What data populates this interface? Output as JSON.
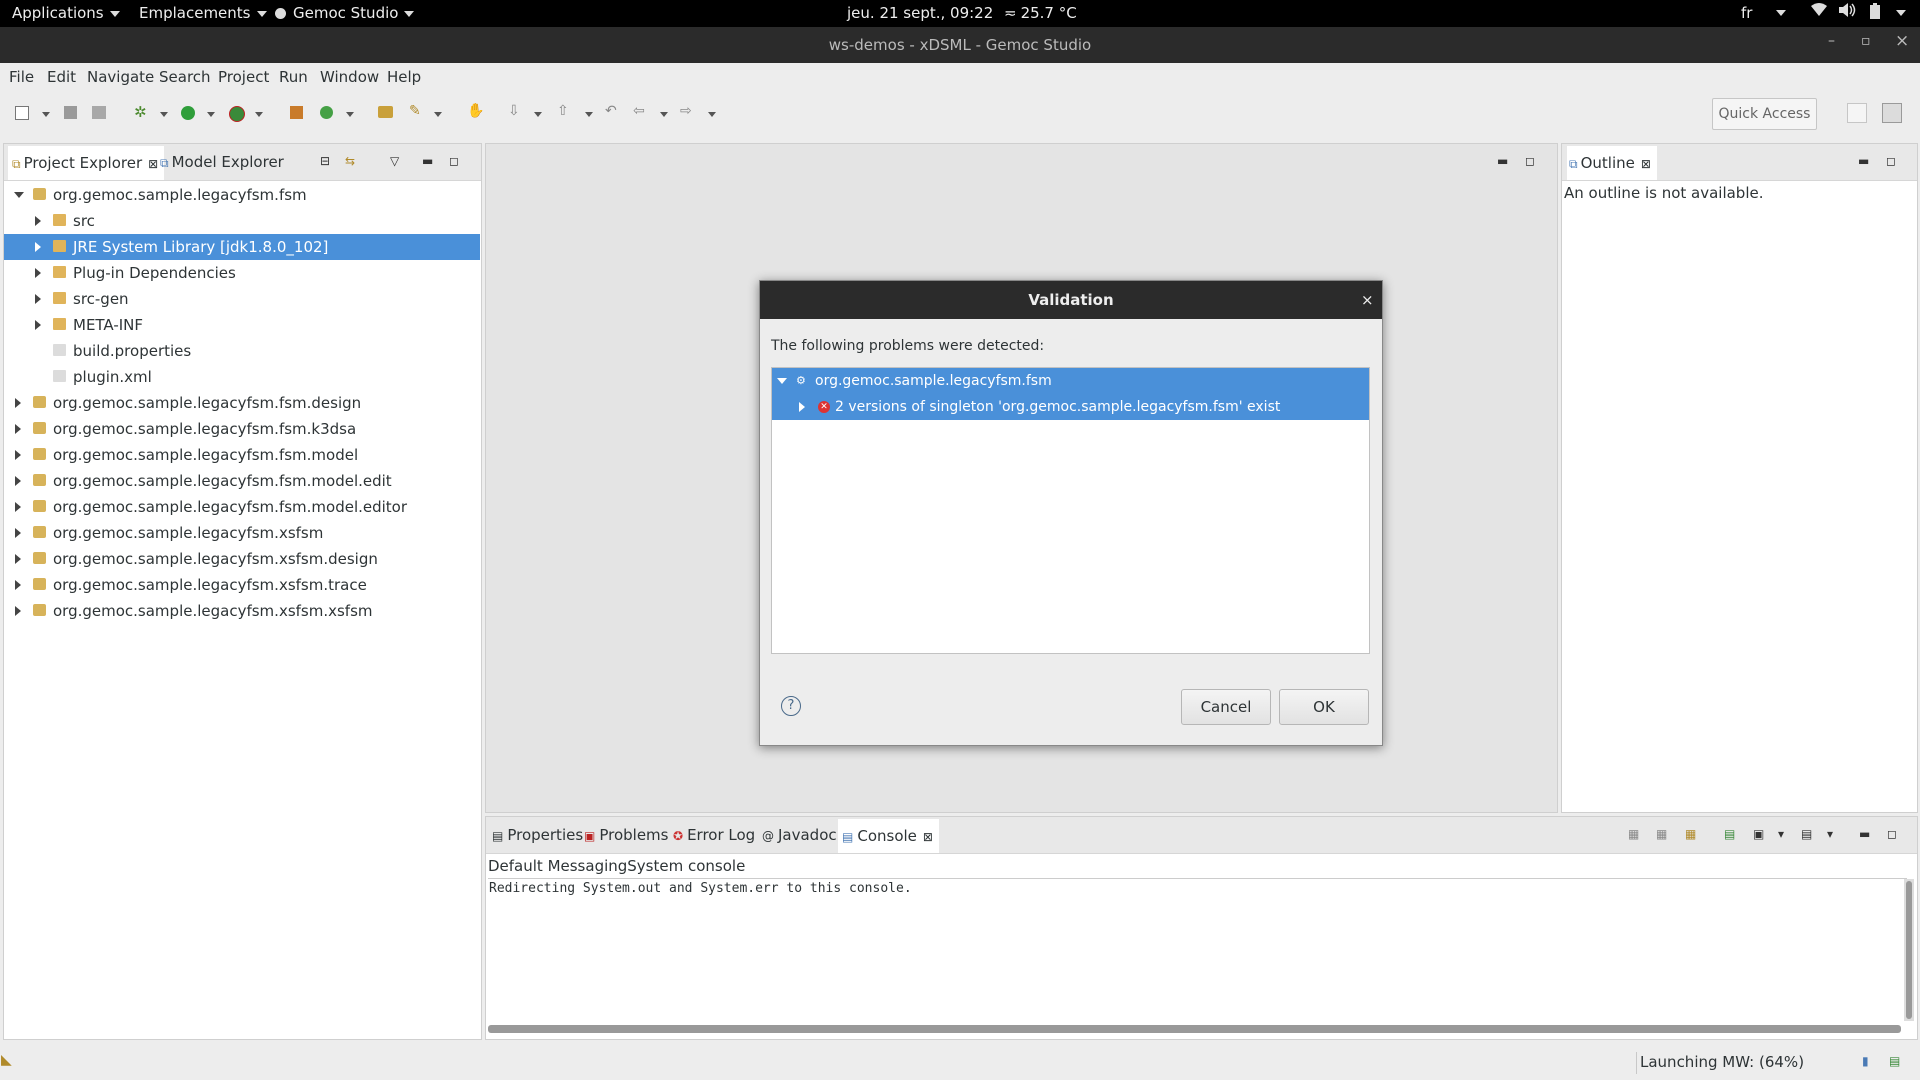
{
  "topbar": {
    "applications": "Applications",
    "places": "Emplacements",
    "app_name": "Gemoc Studio",
    "clock": "jeu. 21 sept., 09:22",
    "temperature": "25.7 °C",
    "lang": "fr"
  },
  "window": {
    "title": "ws-demos - xDSML - Gemoc Studio",
    "minimize": "–",
    "maximize": "▫",
    "close": "×"
  },
  "menubar": [
    "File",
    "Edit",
    "Navigate",
    "Search",
    "Project",
    "Run",
    "Window",
    "Help"
  ],
  "toolbar": {
    "quick_access": "Quick Access"
  },
  "project_explorer": {
    "tabs": [
      "Project Explorer",
      "Model Explorer"
    ],
    "tree": [
      {
        "label": "org.gemoc.sample.legacyfsm.fsm",
        "level": 0,
        "expanded": true,
        "selected": false
      },
      {
        "label": "src",
        "level": 1,
        "expanded": false,
        "selected": false
      },
      {
        "label": "JRE System Library [jdk1.8.0_102]",
        "level": 1,
        "expanded": false,
        "selected": true
      },
      {
        "label": "Plug-in Dependencies",
        "level": 1,
        "expanded": false,
        "selected": false
      },
      {
        "label": "src-gen",
        "level": 1,
        "expanded": false,
        "selected": false
      },
      {
        "label": "META-INF",
        "level": 1,
        "expanded": false,
        "selected": false
      },
      {
        "label": "build.properties",
        "level": 1,
        "leaf": true,
        "selected": false
      },
      {
        "label": "plugin.xml",
        "level": 1,
        "leaf": true,
        "selected": false
      },
      {
        "label": "org.gemoc.sample.legacyfsm.fsm.design",
        "level": 0,
        "expanded": false,
        "selected": false
      },
      {
        "label": "org.gemoc.sample.legacyfsm.fsm.k3dsa",
        "level": 0,
        "expanded": false,
        "selected": false
      },
      {
        "label": "org.gemoc.sample.legacyfsm.fsm.model",
        "level": 0,
        "expanded": false,
        "selected": false
      },
      {
        "label": "org.gemoc.sample.legacyfsm.fsm.model.edit",
        "level": 0,
        "expanded": false,
        "selected": false
      },
      {
        "label": "org.gemoc.sample.legacyfsm.fsm.model.editor",
        "level": 0,
        "expanded": false,
        "selected": false
      },
      {
        "label": "org.gemoc.sample.legacyfsm.xsfsm",
        "level": 0,
        "expanded": false,
        "selected": false
      },
      {
        "label": "org.gemoc.sample.legacyfsm.xsfsm.design",
        "level": 0,
        "expanded": false,
        "selected": false
      },
      {
        "label": "org.gemoc.sample.legacyfsm.xsfsm.trace",
        "level": 0,
        "expanded": false,
        "selected": false
      },
      {
        "label": "org.gemoc.sample.legacyfsm.xsfsm.xsfsm",
        "level": 0,
        "expanded": false,
        "selected": false
      }
    ]
  },
  "outline": {
    "tab": "Outline",
    "message": "An outline is not available."
  },
  "bottom_panel": {
    "tabs": [
      "Properties",
      "Problems",
      "Error Log",
      "Javadoc",
      "Console"
    ],
    "console_name": "Default MessagingSystem console",
    "console_text": "Redirecting System.out and System.err to this console."
  },
  "dialog": {
    "title": "Validation",
    "message": "The following problems were detected:",
    "tree": [
      {
        "label": "org.gemoc.sample.legacyfsm.fsm"
      },
      {
        "label": "2 versions of singleton 'org.gemoc.sample.legacyfsm.fsm' exist"
      }
    ],
    "cancel": "Cancel",
    "ok": "OK",
    "help": "?"
  },
  "statusbar": {
    "progress_text": "Launching MW: (64%)"
  }
}
